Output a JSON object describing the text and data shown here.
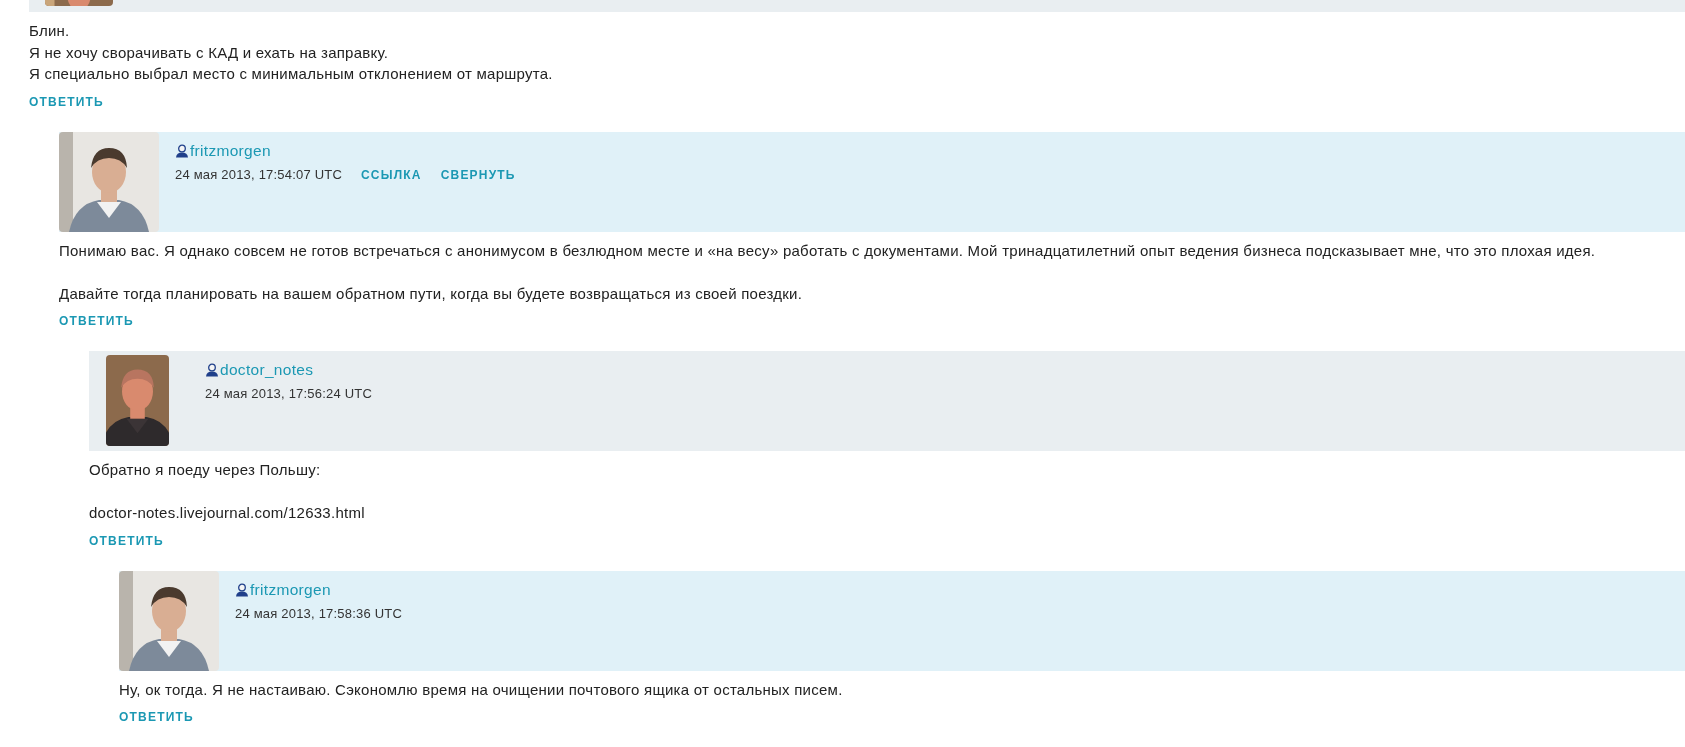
{
  "comments": [
    {
      "kind": "cut",
      "color": "#e9eef1",
      "paragraphs": [
        [
          "Блин.",
          "Я не хочу сворачивать с КАД и ехать на заправку.",
          "Я специально выбрал место с минимальным отклонением от маршрута."
        ]
      ],
      "reply": "ОТВЕТИТЬ",
      "children": [
        {
          "kind": "full",
          "color": "#e0f1f8",
          "avatar": {
            "kind": "square"
          },
          "author": "fritzmorgen",
          "date": "24 мая 2013, 17:54:07 UTC",
          "links": [
            "ССЫЛКА",
            "СВЕРНУТЬ"
          ],
          "paragraphs": [
            [
              "Понимаю вас. Я однако совсем не готов встречаться с анонимусом в безлюдном месте и «на весу» работать с документами. Мой тринадцатилетний опыт ведения бизнеса подсказывает мне, что это плохая идея."
            ],
            [
              "Давайте тогда планировать на вашем обратном пути, когда вы будете возвращаться из своей поездки."
            ]
          ],
          "reply": "ОТВЕТИТЬ",
          "children": [
            {
              "kind": "full",
              "color": "#e9eef1",
              "avatar": {
                "kind": "portrait"
              },
              "author": "doctor_notes",
              "date": "24 мая 2013, 17:56:24 UTC",
              "paragraphs": [
                [
                  "Обратно я поеду через Польшу:"
                ],
                [
                  "doctor-notes.livejournal.com/12633.html"
                ]
              ],
              "reply": "ОТВЕТИТЬ",
              "children": [
                {
                  "kind": "full",
                  "color": "#e0f1f8",
                  "avatar": {
                    "kind": "square"
                  },
                  "author": "fritzmorgen",
                  "date": "24 мая 2013, 17:58:36 UTC",
                  "paragraphs": [
                    [
                      "Ну, ок тогда. Я не настаиваю. Сэкономлю время на очищении почтового ящика от остальных писем."
                    ]
                  ],
                  "reply": "ОТВЕТИТЬ"
                }
              ]
            }
          ]
        }
      ]
    }
  ]
}
